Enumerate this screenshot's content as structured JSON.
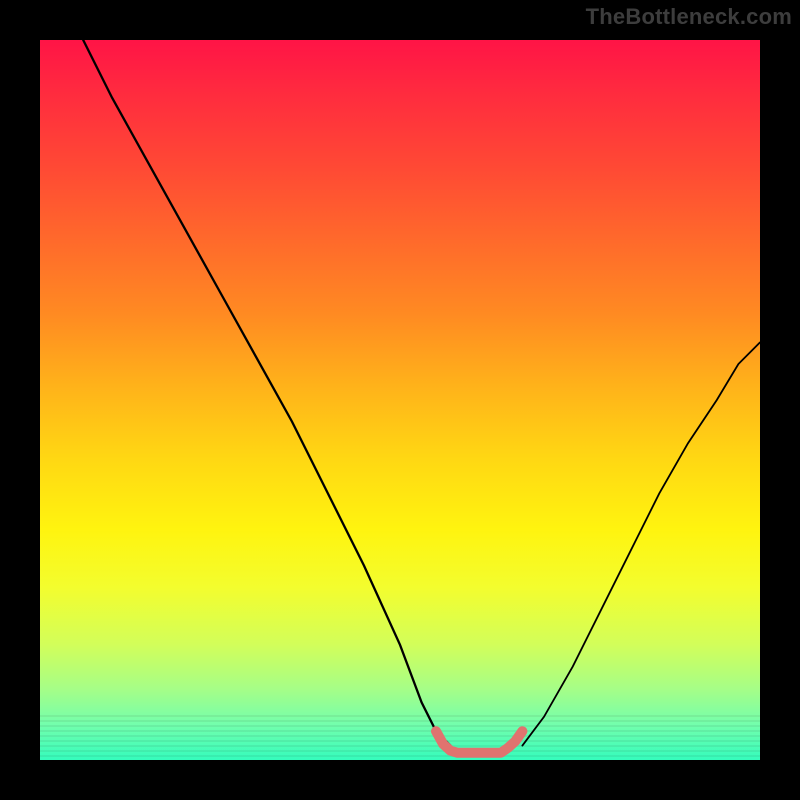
{
  "watermark": "TheBottleneck.com",
  "chart_data": {
    "type": "line",
    "title": "",
    "xlabel": "",
    "ylabel": "",
    "xlim": [
      0,
      100
    ],
    "ylim": [
      0,
      100
    ],
    "grid": false,
    "legend": false,
    "series": [
      {
        "name": "left_arm",
        "color": "#000000",
        "x": [
          6,
          10,
          15,
          20,
          25,
          30,
          35,
          40,
          45,
          50,
          53,
          55,
          57
        ],
        "values": [
          100,
          92,
          83,
          74,
          65,
          56,
          47,
          37,
          27,
          16,
          8,
          4,
          2
        ]
      },
      {
        "name": "right_arm",
        "color": "#000000",
        "x": [
          67,
          70,
          74,
          78,
          82,
          86,
          90,
          94,
          97,
          100
        ],
        "values": [
          2,
          6,
          13,
          21,
          29,
          37,
          44,
          50,
          55,
          58
        ]
      },
      {
        "name": "zone_marker",
        "color": "#e0736f",
        "x": [
          55,
          56,
          57,
          58,
          59,
          60,
          61,
          62,
          63,
          64,
          65,
          66,
          67
        ],
        "values": [
          4,
          2.2,
          1.3,
          1,
          1,
          1,
          1,
          1,
          1,
          1,
          1.7,
          2.6,
          4
        ]
      }
    ],
    "annotations": []
  }
}
